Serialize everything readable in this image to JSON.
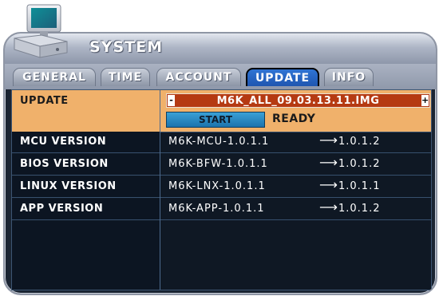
{
  "window": {
    "title": "SYSTEM",
    "icon": "computer-icon"
  },
  "tabs": [
    {
      "label": "GENERAL",
      "active": false
    },
    {
      "label": "TIME",
      "active": false
    },
    {
      "label": "ACCOUNT",
      "active": false
    },
    {
      "label": "UPDATE",
      "active": true
    },
    {
      "label": "INFO",
      "active": false
    }
  ],
  "update": {
    "label": "UPDATE",
    "file_name": "M6K_ALL_09.03.13.11.IMG",
    "prev_symbol": "-",
    "next_symbol": "+",
    "start_label": "START",
    "status": "READY"
  },
  "versions": [
    {
      "label": "MCU VERSION",
      "current": "M6K-MCU-1.0.1.1",
      "arrow": "⟶",
      "new": "1.0.1.2"
    },
    {
      "label": "BIOS VERSION",
      "current": "M6K-BFW-1.0.1.1",
      "arrow": "⟶",
      "new": "1.0.1.2"
    },
    {
      "label": "LINUX VERSION",
      "current": "M6K-LNX-1.0.1.1",
      "arrow": "⟶",
      "new": "1.0.1.1"
    },
    {
      "label": "APP VERSION",
      "current": "M6K-APP-1.0.1.1",
      "arrow": "⟶",
      "new": "1.0.1.2"
    }
  ],
  "colors": {
    "update_row": "#f0b16b",
    "file_bar": "#b53a12",
    "start_button": "#2b8cc4",
    "active_tab": "#2a6ac6",
    "panel": "#0f1824"
  }
}
